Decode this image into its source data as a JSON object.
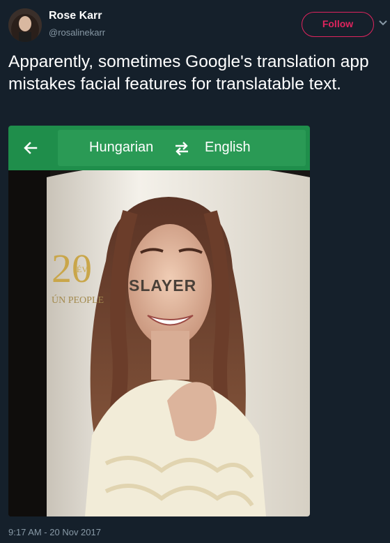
{
  "tweet": {
    "author_name": "Rose Karr",
    "author_handle": "@rosalinekarr",
    "follow_label": "Follow",
    "text": "Apparently, sometimes Google's translation app mistakes facial features for translatable text.",
    "timestamp": "9:17 AM - 20 Nov 2017"
  },
  "translate_app": {
    "source_language": "Hungarian",
    "target_language": "English",
    "detected_overlay_text": "SLAYER"
  },
  "poster": {
    "number": "20",
    "number_suffix": "ÉV",
    "brand": "ÚN PEOPLE"
  },
  "colors": {
    "background": "#15202b",
    "follow_accent": "#e0245e",
    "app_bar": "#1f8e4b",
    "secondary_text": "#8899a6"
  },
  "icons": {
    "back": "arrow-left-icon",
    "swap": "swap-arrows-icon",
    "caret": "chevron-down-icon"
  }
}
